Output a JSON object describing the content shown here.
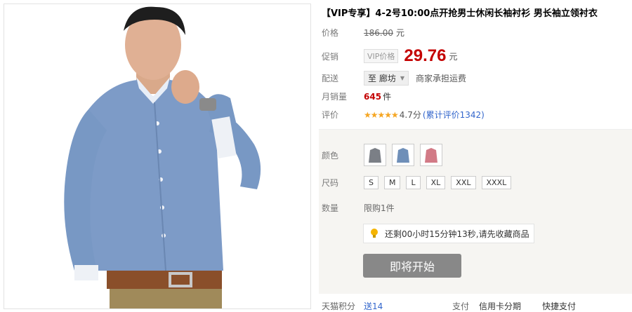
{
  "product": {
    "title": "【VIP专享】4-2号10:00点开抢男士休闲长袖衬衫 男长袖立领衬衣"
  },
  "price_row": {
    "label": "价格",
    "original": "186.00",
    "unit": "元"
  },
  "promo_row": {
    "label": "促销",
    "badge": "VIP价格",
    "price": "29.76",
    "unit": "元"
  },
  "ship_row": {
    "label": "配送",
    "destination": "至 廊坊",
    "note": "商家承担运费"
  },
  "sales_row": {
    "label": "月销量",
    "count": "645",
    "unit": "件"
  },
  "rating_row": {
    "label": "评价",
    "stars": "★★★★★",
    "score": "4.7分",
    "reviews": "(累计评价1342)"
  },
  "color_row": {
    "label": "颜色",
    "swatches": [
      {
        "name": "grey-shirt",
        "color": "#7b7f86"
      },
      {
        "name": "blue-shirt",
        "color": "#6f8fb8"
      },
      {
        "name": "pink-shirt",
        "color": "#d27a86"
      }
    ]
  },
  "size_row": {
    "label": "尺码",
    "sizes": [
      "S",
      "M",
      "L",
      "XL",
      "XXL",
      "XXXL"
    ]
  },
  "qty_row": {
    "label": "数量",
    "limit": "限购1件"
  },
  "reminder": {
    "text": "还剩00小时15分钟13秒,请先收藏商品"
  },
  "start_button": {
    "label": "即将开始"
  },
  "bottom": {
    "left": "天猫积分",
    "left_val": "送14",
    "right": "支付",
    "card": "信用卡分期",
    "more": "快捷支付"
  }
}
